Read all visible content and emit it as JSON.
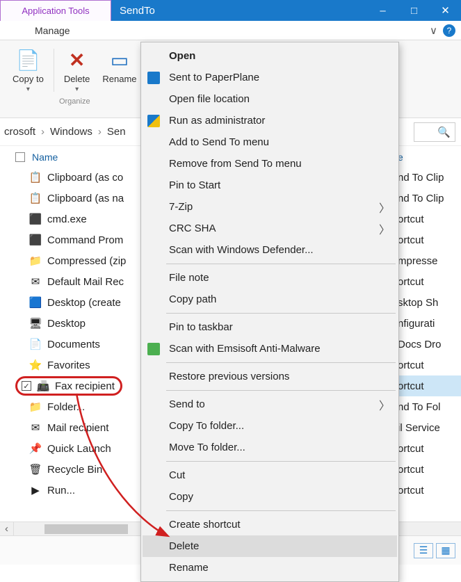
{
  "window": {
    "app_tools_tab": "Application Tools",
    "title": "SendTo",
    "manage_tab": "Manage"
  },
  "ribbon": {
    "copy_to": "Copy to",
    "delete": "Delete",
    "rename": "Rename",
    "group_label": "Organize"
  },
  "breadcrumb": {
    "parts": [
      "crosoft",
      "Windows",
      "Sen"
    ]
  },
  "columns": {
    "name": "Name",
    "type": "e"
  },
  "files": [
    {
      "label": "Clipboard (as co",
      "type": "nd To Clip",
      "icon": "clip"
    },
    {
      "label": "Clipboard (as na",
      "type": "nd To Clip",
      "icon": "clip"
    },
    {
      "label": "cmd.exe",
      "type": "ortcut",
      "icon": "cmd"
    },
    {
      "label": "Command Prom",
      "type": "ortcut",
      "icon": "cmd2"
    },
    {
      "label": "Compressed (zip",
      "type": "mpresse",
      "icon": "zip"
    },
    {
      "label": "Default Mail Rec",
      "type": "ortcut",
      "icon": "mail"
    },
    {
      "label": "Desktop (create",
      "type": "sktop Sh",
      "icon": "desk"
    },
    {
      "label": "Desktop",
      "type": "nfigurati",
      "icon": "desk2"
    },
    {
      "label": "Documents",
      "type": "Docs Dro",
      "icon": "docs"
    },
    {
      "label": "Favorites",
      "type": "ortcut",
      "icon": "fav"
    },
    {
      "label": "Fax recipient",
      "type": "ortcut",
      "icon": "fax",
      "selected": true
    },
    {
      "label": "Folder...",
      "type": "nd To Fol",
      "icon": "folder"
    },
    {
      "label": "Mail recipient",
      "type": "il Service",
      "icon": "mail2"
    },
    {
      "label": "Quick Launch",
      "type": "ortcut",
      "icon": "ql"
    },
    {
      "label": "Recycle Bin",
      "type": "ortcut",
      "icon": "bin"
    },
    {
      "label": "Run...",
      "type": "ortcut",
      "icon": "run"
    }
  ],
  "context_menu": [
    {
      "label": "Open",
      "bold": true
    },
    {
      "label": "Sent to PaperPlane",
      "icon": "plane"
    },
    {
      "label": "Open file location"
    },
    {
      "label": "Run as administrator",
      "icon": "shield"
    },
    {
      "label": "Add to Send To menu"
    },
    {
      "label": "Remove from Send To menu"
    },
    {
      "label": "Pin to Start"
    },
    {
      "label": "7-Zip",
      "submenu": true
    },
    {
      "label": "CRC SHA",
      "submenu": true
    },
    {
      "label": "Scan with Windows Defender..."
    },
    {
      "sep": true
    },
    {
      "label": "File note"
    },
    {
      "label": "Copy path"
    },
    {
      "sep": true
    },
    {
      "label": "Pin to taskbar"
    },
    {
      "label": "Scan with Emsisoft Anti-Malware",
      "icon": "green"
    },
    {
      "sep": true
    },
    {
      "label": "Restore previous versions"
    },
    {
      "sep": true
    },
    {
      "label": "Send to",
      "submenu": true
    },
    {
      "label": "Copy To folder..."
    },
    {
      "label": "Move To folder..."
    },
    {
      "sep": true
    },
    {
      "label": "Cut"
    },
    {
      "label": "Copy"
    },
    {
      "sep": true
    },
    {
      "label": "Create shortcut"
    },
    {
      "label": "Delete",
      "hover": true
    },
    {
      "label": "Rename"
    }
  ]
}
